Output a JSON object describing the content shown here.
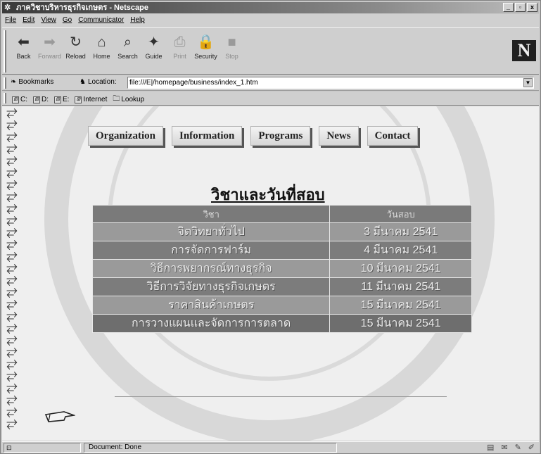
{
  "window": {
    "title": "ภาควิชาบริหารธุรกิจเกษตร - Netscape",
    "controls": [
      "_",
      "▫",
      "x"
    ]
  },
  "menu": [
    "File",
    "Edit",
    "View",
    "Go",
    "Communicator",
    "Help"
  ],
  "toolbar": {
    "buttons": [
      {
        "label": "Back",
        "icon": "back-arrow-icon",
        "glyph": "⬅",
        "enabled": true
      },
      {
        "label": "Forward",
        "icon": "forward-arrow-icon",
        "glyph": "➡",
        "enabled": false
      },
      {
        "label": "Reload",
        "icon": "reload-icon",
        "glyph": "↻",
        "enabled": true
      },
      {
        "label": "Home",
        "icon": "home-icon",
        "glyph": "⌂",
        "enabled": true
      },
      {
        "label": "Search",
        "icon": "search-icon",
        "glyph": "⌕",
        "enabled": true
      },
      {
        "label": "Guide",
        "icon": "guide-icon",
        "glyph": "✦",
        "enabled": true
      },
      {
        "label": "Print",
        "icon": "print-icon",
        "glyph": "⎙",
        "enabled": false
      },
      {
        "label": "Security",
        "icon": "lock-icon",
        "glyph": "🔒",
        "enabled": true
      },
      {
        "label": "Stop",
        "icon": "stop-icon",
        "glyph": "■",
        "enabled": false
      }
    ],
    "logo": "N"
  },
  "location": {
    "bookmarks_label": "Bookmarks",
    "location_label": "Location:",
    "url": "file:///E|/homepage/business/index_1.htm"
  },
  "links": [
    {
      "label": "C:",
      "icon": "drive-icon"
    },
    {
      "label": "D:",
      "icon": "drive-icon"
    },
    {
      "label": "E:",
      "icon": "drive-icon"
    },
    {
      "label": "Internet",
      "icon": "bookmark-icon"
    },
    {
      "label": "Lookup",
      "icon": "folder-icon"
    }
  ],
  "page": {
    "nav": [
      "Organization",
      "Information",
      "Programs",
      "News",
      "Contact"
    ],
    "heading": "วิชาและวันที่สอบ",
    "table": {
      "headers": [
        "วิชา",
        "วันสอบ"
      ],
      "rows": [
        [
          "จิตวิทยาทั่วไป",
          "3 มีนาคม 2541"
        ],
        [
          "การจัดการฟาร์ม",
          "4 มีนาคม 2541"
        ],
        [
          "วิธีการพยากรณ์ทางธุรกิจ",
          "10 มีนาคม 2541"
        ],
        [
          "วิธีการวิจัยทางธุรกิจเกษตร",
          "11 มีนาคม 2541"
        ],
        [
          "ราคาสินค้าเกษตร",
          "15 มีนาคม 2541"
        ],
        [
          "การวางแผนและจัดการการตลาด",
          "15 มีนาคม 2541"
        ]
      ]
    }
  },
  "status": {
    "message": "Document: Done"
  }
}
